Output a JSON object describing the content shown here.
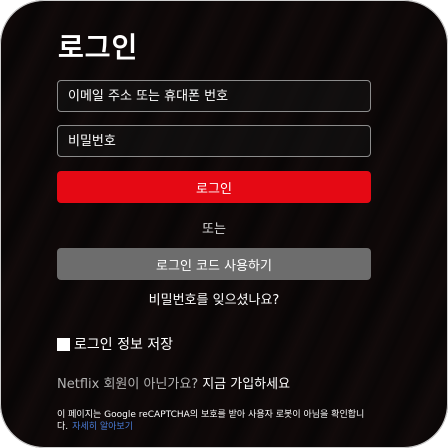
{
  "login": {
    "title": "로그인",
    "email_placeholder": "이메일 주소 또는 휴대폰 번호",
    "password_placeholder": "비밀번호",
    "login_button": "로그인",
    "or_text": "또는",
    "code_button": "로그인 코드 사용하기",
    "forgot_password": "비밀번호를 잊으셨나요?",
    "remember_me": "로그인 정보 저장",
    "signup_prompt": "Netflix 회원이 아닌가요?",
    "signup_link": "지금 가입하세요",
    "recaptcha_text": "이 페이지는 Google reCAPTCHA의 보호를 받아 사용자 로봇이 아님을 확인합니다.",
    "learn_more": "자세히 알아보기"
  },
  "colors": {
    "accent": "#e50914",
    "secondary_button": "#6d6d6d",
    "link": "#4a7bd6"
  }
}
